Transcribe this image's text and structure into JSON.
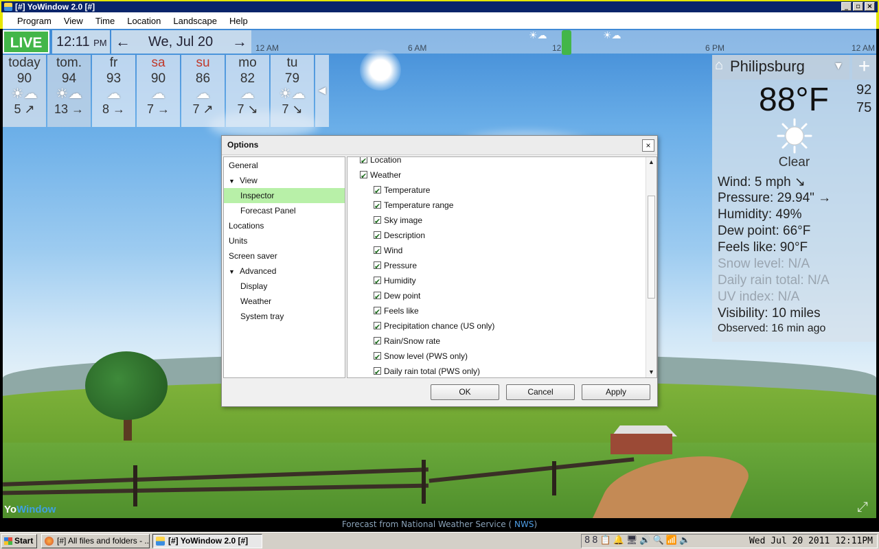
{
  "window": {
    "title": "[#] YoWindow 2.0 [#]"
  },
  "menu": [
    "Program",
    "View",
    "Time",
    "Location",
    "Landscape",
    "Help"
  ],
  "topbar": {
    "live": "LIVE",
    "time": "12:11",
    "ampm": "PM",
    "date": "We, Jul 20",
    "prev_arrow": "←",
    "next_arrow": "→",
    "timeline_ticks": [
      "12 AM",
      "6 AM",
      "12",
      "6 PM",
      "12 AM"
    ]
  },
  "forecast": [
    {
      "day": "today",
      "temp": "90",
      "icon": "partly-sunny-icon",
      "wind": "5 ↗",
      "weekend": false
    },
    {
      "day": "tom.",
      "temp": "94",
      "icon": "partly-sunny-icon",
      "wind": "13 →",
      "weekend": false
    },
    {
      "day": "fr",
      "temp": "93",
      "icon": "cloud-icon",
      "wind": "8 →",
      "weekend": false
    },
    {
      "day": "sa",
      "temp": "90",
      "icon": "cloud-icon",
      "wind": "7 →",
      "weekend": true
    },
    {
      "day": "su",
      "temp": "86",
      "icon": "cloud-icon",
      "wind": "7 ↗",
      "weekend": true
    },
    {
      "day": "mo",
      "temp": "82",
      "icon": "cloud-icon",
      "wind": "7 ↘",
      "weekend": false
    },
    {
      "day": "tu",
      "temp": "79",
      "icon": "partly-sunny-icon",
      "wind": "7 ↘",
      "weekend": false
    }
  ],
  "inspector": {
    "location": "Philipsburg",
    "add": "+",
    "temperature": "88°F",
    "high": "92",
    "low": "75",
    "description": "Clear",
    "rows": [
      {
        "text": "Wind:  5 mph  ↘",
        "dim": false
      },
      {
        "text": "Pressure:  29.94\" →",
        "dim": false
      },
      {
        "text": "Humidity:  49%",
        "dim": false
      },
      {
        "text": "Dew point:  66°F",
        "dim": false
      },
      {
        "text": "Feels like:  90°F",
        "dim": false
      },
      {
        "text": "Snow level:  N/A",
        "dim": true
      },
      {
        "text": "Daily rain total:  N/A",
        "dim": true
      },
      {
        "text": "UV index:  N/A",
        "dim": true
      },
      {
        "text": "Visibility:  10 miles",
        "dim": false
      }
    ],
    "observed": "Observed:  16 min ago"
  },
  "dialog": {
    "title": "Options",
    "close": "×",
    "nav": [
      {
        "label": "General",
        "level": 1,
        "expander": "",
        "selected": false
      },
      {
        "label": "View",
        "level": 1,
        "expander": "▼",
        "selected": false
      },
      {
        "label": "Inspector",
        "level": 2,
        "expander": "",
        "selected": true
      },
      {
        "label": "Forecast Panel",
        "level": 2,
        "expander": "",
        "selected": false
      },
      {
        "label": "Locations",
        "level": 1,
        "expander": "",
        "selected": false
      },
      {
        "label": "Units",
        "level": 1,
        "expander": "",
        "selected": false
      },
      {
        "label": "Screen saver",
        "level": 1,
        "expander": "",
        "selected": false
      },
      {
        "label": "Advanced",
        "level": 1,
        "expander": "▼",
        "selected": false
      },
      {
        "label": "Display",
        "level": 2,
        "expander": "",
        "selected": false
      },
      {
        "label": "Weather",
        "level": 2,
        "expander": "",
        "selected": false
      },
      {
        "label": "System tray",
        "level": 2,
        "expander": "",
        "selected": false
      }
    ],
    "options": [
      {
        "label": "Location",
        "level": 1,
        "checked": true
      },
      {
        "label": "Weather",
        "level": 1,
        "checked": true
      },
      {
        "label": "Temperature",
        "level": 2,
        "checked": true
      },
      {
        "label": "Temperature range",
        "level": 2,
        "checked": true
      },
      {
        "label": "Sky image",
        "level": 2,
        "checked": true
      },
      {
        "label": "Description",
        "level": 2,
        "checked": true
      },
      {
        "label": "Wind",
        "level": 2,
        "checked": true
      },
      {
        "label": "Pressure",
        "level": 2,
        "checked": true
      },
      {
        "label": "Humidity",
        "level": 2,
        "checked": true
      },
      {
        "label": "Dew point",
        "level": 2,
        "checked": true
      },
      {
        "label": "Feels like",
        "level": 2,
        "checked": true
      },
      {
        "label": "Precipitation chance (US only)",
        "level": 2,
        "checked": true
      },
      {
        "label": "Rain/Snow rate",
        "level": 2,
        "checked": true
      },
      {
        "label": "Snow level (PWS only)",
        "level": 2,
        "checked": true
      },
      {
        "label": "Daily rain total (PWS only)",
        "level": 2,
        "checked": true
      }
    ],
    "buttons": {
      "ok": "OK",
      "cancel": "Cancel",
      "apply": "Apply"
    }
  },
  "status": {
    "text": "Forecast from National Weather Service (",
    "link": "NWS",
    "close": ")"
  },
  "logo": {
    "yo": "Yo",
    "window": "Window"
  },
  "taskbar": {
    "start": "Start",
    "tasks": [
      "[#] All files and folders - ...",
      "[#] YoWindow 2.0 [#]"
    ],
    "tray_icons": "88📋🔔🖥🔊🔍📶🔈",
    "clock": "Wed Jul 20 2011 12:11PM"
  }
}
